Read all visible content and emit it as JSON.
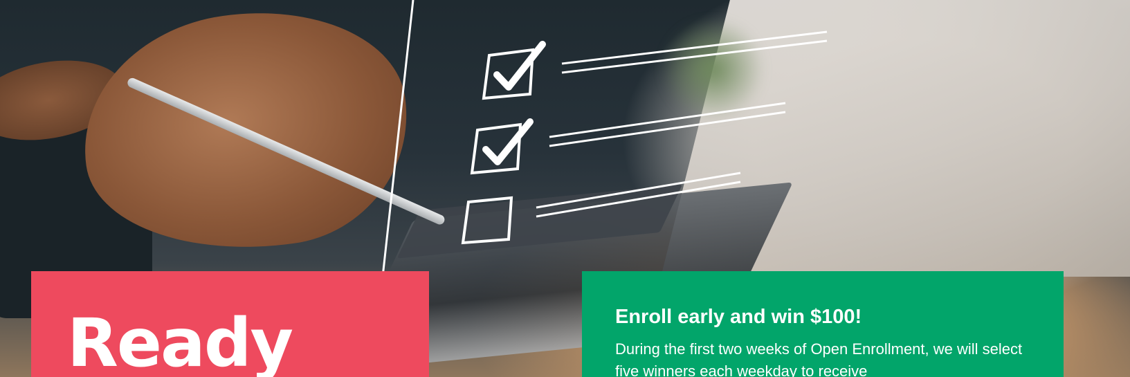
{
  "hero": {
    "image_alt": "hand holding pen checking boxes on virtual checklist above laptop",
    "checklist": {
      "checked_count": 2,
      "total_count": 3
    }
  },
  "red_card": {
    "heading": "Ready",
    "color": "#ee4a5e"
  },
  "green_card": {
    "heading": "Enroll early and win $100!",
    "body": "During the first two weeks of Open Enrollment, we will select five winners each weekday to receive",
    "color": "#02a56a"
  }
}
